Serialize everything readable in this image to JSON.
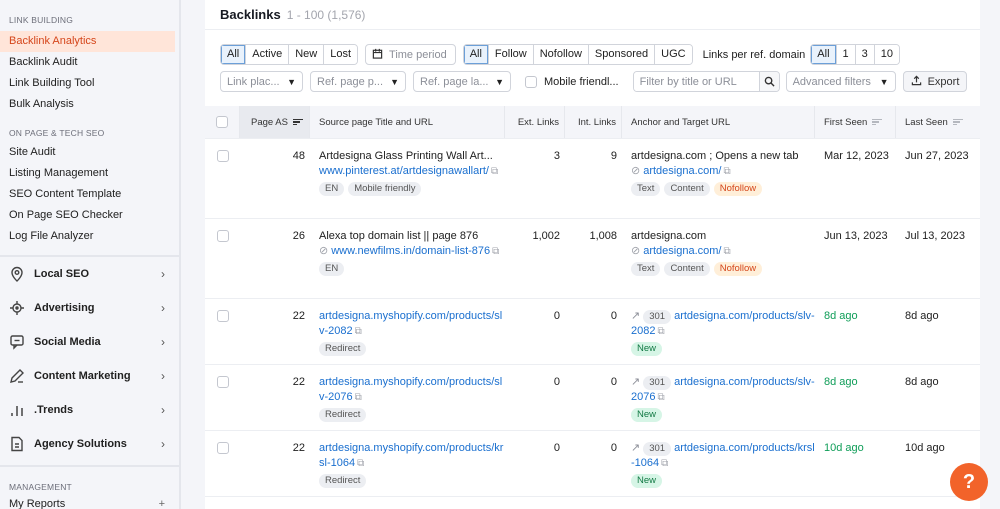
{
  "sidebar": {
    "sections": [
      {
        "title": "LINK BUILDING",
        "items": [
          {
            "label": "Backlink Analytics",
            "active": true
          },
          {
            "label": "Backlink Audit"
          },
          {
            "label": "Link Building Tool"
          },
          {
            "label": "Bulk Analysis"
          }
        ]
      },
      {
        "title": "ON PAGE & TECH SEO",
        "items": [
          {
            "label": "Site Audit"
          },
          {
            "label": "Listing Management"
          },
          {
            "label": "SEO Content Template"
          },
          {
            "label": "On Page SEO Checker"
          },
          {
            "label": "Log File Analyzer"
          }
        ]
      }
    ],
    "categories": [
      {
        "label": "Local SEO",
        "icon": "location-pin-icon"
      },
      {
        "label": "Advertising",
        "icon": "crosshair-icon"
      },
      {
        "label": "Social Media",
        "icon": "chat-bubble-icon"
      },
      {
        "label": "Content Marketing",
        "icon": "pencil-icon"
      },
      {
        "label": ".Trends",
        "icon": "bar-chart-icon"
      },
      {
        "label": "Agency Solutions",
        "icon": "document-icon"
      }
    ],
    "management_title": "MANAGEMENT",
    "my_reports": "My Reports",
    "my_reports_add": "+"
  },
  "panel": {
    "title": "Backlinks",
    "count": "1 - 100 (1,576)"
  },
  "filters": {
    "status": [
      "All",
      "Active",
      "New",
      "Lost"
    ],
    "status_selected": "All",
    "time_period": "Time period",
    "link_type": [
      "All",
      "Follow",
      "Nofollow",
      "Sponsored",
      "UGC"
    ],
    "link_type_selected": "All",
    "links_per_domain_label": "Links per ref. domain",
    "links_per_domain": [
      "All",
      "1",
      "3",
      "10"
    ],
    "links_per_domain_selected": "All",
    "link_placement": "Link plac...",
    "ref_page_platform": "Ref. page p...",
    "ref_page_language": "Ref. page la...",
    "mobile_friendly": "Mobile friendl...",
    "search_placeholder": "Filter by title or URL",
    "advanced_filters": "Advanced filters",
    "export": "Export"
  },
  "table": {
    "columns": {
      "page_as": "Page AS",
      "source": "Source page Title and URL",
      "ext": "Ext. Links",
      "int": "Int. Links",
      "anchor": "Anchor and Target URL",
      "first_seen": "First Seen",
      "last_seen": "Last Seen"
    },
    "rows": [
      {
        "page_as": "48",
        "source_title": "Artdesigna Glass Printing Wall Art...",
        "source_url": "www.pinterest.at/artdesignawallart/",
        "source_tags": [
          "EN",
          "Mobile friendly"
        ],
        "ext": "3",
        "int": "9",
        "anchor": "artdesigna.com ; Opens a new tab",
        "target_url": "artdesigna.com/",
        "anchor_tags": [
          "Text",
          "Content",
          "Nofollow"
        ],
        "first_seen": "Mar 12, 2023",
        "last_seen": "Jun 27, 2023"
      },
      {
        "page_as": "26",
        "source_title": "Alexa top domain list || page 876",
        "source_url": "www.newfilms.in/domain-list-876",
        "source_tags": [
          "EN"
        ],
        "ext": "1,002",
        "int": "1,008",
        "anchor": "artdesigna.com",
        "target_url": "artdesigna.com/",
        "anchor_tags": [
          "Text",
          "Content",
          "Nofollow"
        ],
        "first_seen": "Jun 13, 2023",
        "last_seen": "Jul 13, 2023"
      },
      {
        "page_as": "22",
        "source_url": "artdesigna.myshopify.com/products/slv-2082",
        "source_tags": [
          "Redirect"
        ],
        "ext": "0",
        "int": "0",
        "redirect_code": "301",
        "target_url": "artdesigna.com/products/slv-2082",
        "anchor_tags": [
          "New"
        ],
        "first_seen": "8d ago",
        "last_seen": "8d ago"
      },
      {
        "page_as": "22",
        "source_url": "artdesigna.myshopify.com/products/slv-2076",
        "source_tags": [
          "Redirect"
        ],
        "ext": "0",
        "int": "0",
        "redirect_code": "301",
        "target_url": "artdesigna.com/products/slv-2076",
        "anchor_tags": [
          "New"
        ],
        "first_seen": "8d ago",
        "last_seen": "8d ago"
      },
      {
        "page_as": "22",
        "source_url": "artdesigna.myshopify.com/products/krsl-1064",
        "source_tags": [
          "Redirect"
        ],
        "ext": "0",
        "int": "0",
        "redirect_code": "301",
        "target_url": "artdesigna.com/products/krsl-1064",
        "anchor_tags": [
          "New"
        ],
        "first_seen": "10d ago",
        "last_seen": "10d ago"
      }
    ]
  },
  "help_button": "?",
  "colors": {
    "accent": "#d5461b",
    "active_bg": "#ffe5d9",
    "link": "#1a6fcf",
    "help": "#f2632a",
    "new_green": "#0f9d58"
  }
}
